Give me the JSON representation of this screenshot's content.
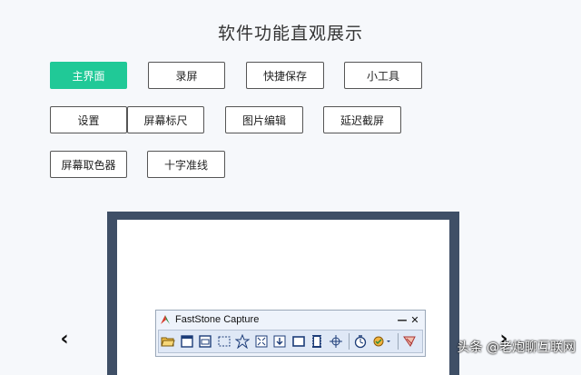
{
  "page": {
    "title": "软件功能直观展示"
  },
  "buttons": [
    {
      "label": "主界面",
      "active": true
    },
    {
      "label": "录屏"
    },
    {
      "label": "快捷保存"
    },
    {
      "label": "小工具"
    },
    {
      "label": "设置"
    },
    {
      "label": "屏幕标尺"
    },
    {
      "label": "图片编辑"
    },
    {
      "label": "延迟截屏"
    },
    {
      "label": "屏幕取色器"
    },
    {
      "label": "十字准线"
    }
  ],
  "carousel": {
    "prev_icon": "chevron-left-icon",
    "next_icon": "chevron-right-icon",
    "prev_glyph": "‹",
    "next_glyph": "›"
  },
  "app_window": {
    "title": "FastStone Capture",
    "minimize_glyph": "—",
    "close_glyph": "✕",
    "toolbar_icons": [
      "open-folder-icon",
      "capture-window-icon",
      "capture-object-icon",
      "capture-rectangle-icon",
      "capture-freehand-icon",
      "capture-fullscreen-icon",
      "capture-scrolling-icon",
      "capture-fixed-region-icon",
      "screen-recorder-icon",
      "crosshair-icon",
      "delay-timer-icon",
      "output-destination-icon",
      "settings-menu-icon"
    ]
  },
  "watermark": {
    "text": "头条 @老炮聊互联网"
  },
  "colors": {
    "accent": "#20c997",
    "frame": "#3f4f66",
    "background": "#f6f8fb"
  }
}
